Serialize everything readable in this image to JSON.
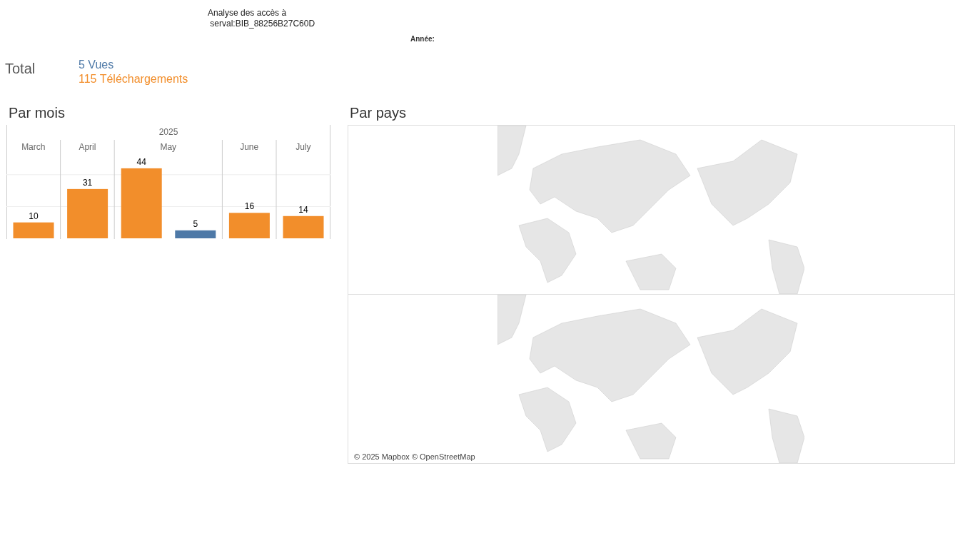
{
  "header": {
    "title_lines": [
      "Analyse des accès à",
      " serval:BIB_88256B27C60D"
    ],
    "year_filter_label": "Année:"
  },
  "total": {
    "label": "Total",
    "items": [
      {
        "text": "5 Vues",
        "color": "#4e79a7"
      },
      {
        "text": "115 Téléchargements",
        "color": "#f28e2b"
      }
    ]
  },
  "by_month": {
    "title": "Par mois",
    "chart_data": {
      "type": "bar",
      "title": "2025",
      "categories": [
        "March",
        "April",
        "May",
        "June",
        "July"
      ],
      "data_labels": true,
      "ref_lines": [
        {
          "axis": "y",
          "value": 20
        },
        {
          "axis": "y",
          "value": 40
        }
      ],
      "series": [
        {
          "color": "#f28e2b",
          "values": [
            10,
            31,
            44,
            16,
            14
          ]
        },
        {
          "color": "#4e79a7",
          "values": [
            null,
            null,
            5,
            null,
            null
          ]
        }
      ]
    }
  },
  "by_country": {
    "title": "Par pays",
    "attribution": "© 2025 Mapbox © OpenStreetMap"
  }
}
